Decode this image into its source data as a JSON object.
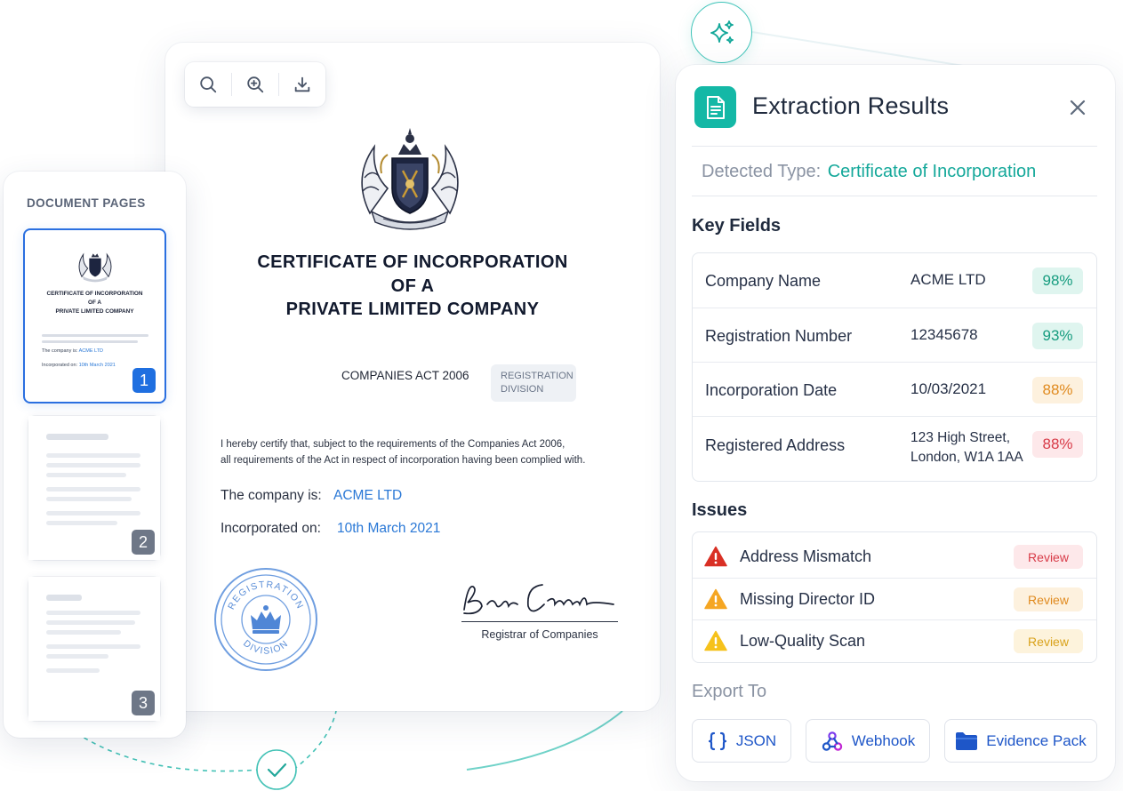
{
  "viewer": {
    "certificate": {
      "title_lines": [
        "CERTIFICATE OF INCORPORATION",
        "OF A",
        "PRIVATE LIMITED COMPANY"
      ],
      "act": "COMPANIES ACT 2006",
      "division_badge": [
        "REGISTRATION",
        "DIVISION"
      ],
      "certify_lines": [
        "I hereby certify that, subject to the requirements of the Companies Act 2006,",
        "all requirements of the Act in respect of incorporation having been complied with."
      ],
      "company_label": "The company is:",
      "company_value": "ACME LTD",
      "incorporated_label": "Incorporated on:",
      "incorporated_value": "10th March 2021",
      "seal_text_top": "REGISTRATION",
      "seal_text_bottom": "DIVISION",
      "signature_caption": "Registrar of Companies"
    }
  },
  "pages": {
    "heading": "DOCUMENT PAGES",
    "thumbnails": [
      {
        "number": "1",
        "title_lines": [
          "CERTIFICATE OF INCORPORATION",
          "OF A",
          "PRIVATE LIMITED COMPANY"
        ],
        "company_label": "The company is:",
        "company_value": "ACME LTD",
        "incorporated_label": "Incorporated on:",
        "incorporated_value": "10th March 2021"
      },
      {
        "number": "2"
      },
      {
        "number": "3"
      }
    ]
  },
  "extraction": {
    "title": "Extraction Results",
    "detected_label": "Detected Type:",
    "detected_value": "Certificate of Incorporation",
    "key_fields_heading": "Key Fields",
    "fields": [
      {
        "label": "Company Name",
        "value_lines": [
          "ACME LTD"
        ],
        "confidence": "98%",
        "level": "high"
      },
      {
        "label": "Registration Number",
        "value_lines": [
          "12345678"
        ],
        "confidence": "93%",
        "level": "high"
      },
      {
        "label": "Incorporation Date",
        "value_lines": [
          "10/03/2021"
        ],
        "confidence": "88%",
        "level": "medium"
      },
      {
        "label": "Registered Address",
        "value_lines": [
          "123 High Street,",
          "London, W1A 1AA"
        ],
        "confidence": "88%",
        "level": "low"
      }
    ],
    "issues_heading": "Issues",
    "issues": [
      {
        "label": "Address Mismatch",
        "action": "Review",
        "severity": "error"
      },
      {
        "label": "Missing Director ID",
        "action": "Review",
        "severity": "warning"
      },
      {
        "label": "Low-Quality Scan",
        "action": "Review",
        "severity": "caution"
      }
    ],
    "export_heading": "Export To",
    "exports": [
      {
        "label": "JSON",
        "icon": "braces-icon"
      },
      {
        "label": "Webhook",
        "icon": "webhook-icon"
      },
      {
        "label": "Evidence Pack",
        "icon": "folder-icon"
      }
    ]
  },
  "colors": {
    "accent_teal": "#14b8a6",
    "link_blue": "#2a78d6",
    "high_bg": "#dff5ef",
    "high_fg": "#169c7f",
    "medium_bg": "#fdf1de",
    "medium_fg": "#e08a1e",
    "low_bg": "#fde8ea",
    "low_fg": "#d83b48",
    "error": "#d93025",
    "warning": "#f5a623",
    "caution": "#f6c21c"
  }
}
